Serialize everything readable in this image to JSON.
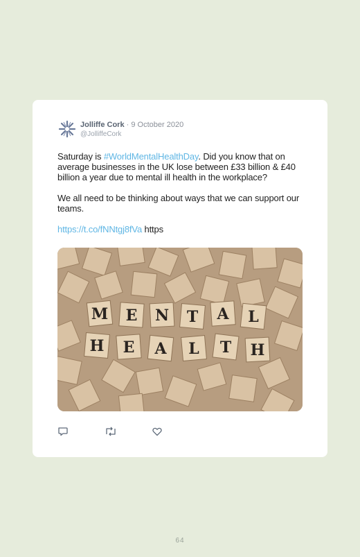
{
  "tweet": {
    "author_name": "Jolliffe Cork",
    "separator": "·",
    "date": "9 October 2020",
    "handle": "@JolliffeCork",
    "text_before_hashtag": "Saturday is ",
    "hashtag": "#WorldMentalHealthDay",
    "text_after_hashtag": ". Did you know that on average businesses in the UK lose between £33 billion & £40 billion a year due to mental ill health in the workplace?",
    "paragraph_2": "We all need to be thinking about ways that we can support our teams.",
    "link": "https://t.co/fNNtgj8fVa",
    "link_trailing": " https",
    "image_tiles_row1": [
      "M",
      "E",
      "N",
      "T",
      "A",
      "L"
    ],
    "image_tiles_row2": [
      "H",
      "E",
      "A",
      "L",
      "T",
      "H"
    ],
    "icons": [
      "reply-icon",
      "retweet-icon",
      "like-icon"
    ]
  },
  "page": {
    "number": "64"
  },
  "colors": {
    "background": "#e6ecdc",
    "card": "#ffffff",
    "link": "#5fb6e4"
  }
}
